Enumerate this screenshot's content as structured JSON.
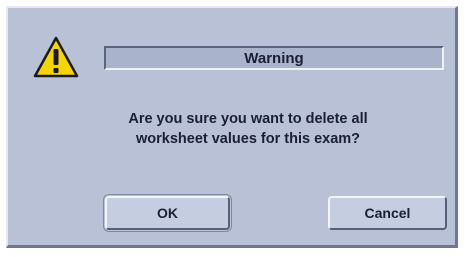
{
  "dialog": {
    "title": "Warning",
    "message_line1": "Are you sure you want to delete all",
    "message_line2": "worksheet values for this exam?",
    "icon": "warning-icon"
  },
  "buttons": {
    "ok_label": "OK",
    "cancel_label": "Cancel"
  },
  "colors": {
    "dialog_bg": "#b8c1d6",
    "warning_yellow": "#f5d400",
    "text": "#1b1f33"
  }
}
